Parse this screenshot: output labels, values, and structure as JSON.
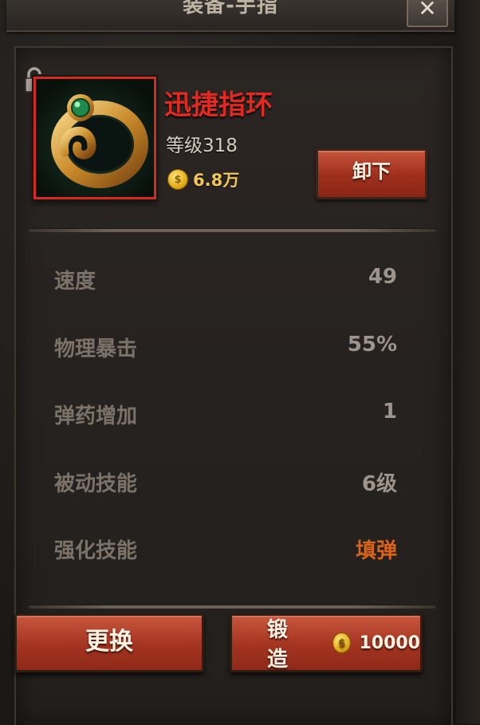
{
  "header": {
    "title": "装备-手指",
    "close_symbol": "✕"
  },
  "item": {
    "name": "迅捷指环",
    "level": "等级318",
    "price": "6.8万",
    "icon": "jade-ring-icon",
    "locked": false
  },
  "actions": {
    "unequip_label": "卸下",
    "swap_label": "更换",
    "forge_label": "锻造",
    "forge_cost": "10000"
  },
  "coin_glyph": "$",
  "stats": [
    {
      "label": "速度",
      "value": "49"
    },
    {
      "label": "物理暴击",
      "value": "55%"
    },
    {
      "label": "弹药增加",
      "value": "1"
    },
    {
      "label": "被动技能",
      "value": "6级"
    },
    {
      "label": "强化技能",
      "value": "填弹"
    }
  ],
  "colors": {
    "item_name": "#e02a20",
    "item_border": "#d42a22",
    "special_skill": "#d8631a",
    "button": "#a33421"
  }
}
